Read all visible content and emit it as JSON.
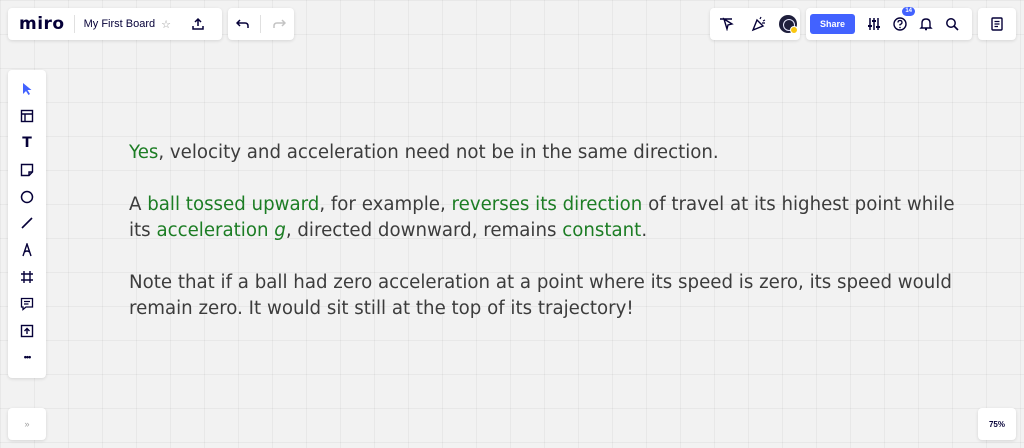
{
  "colors": {
    "accent": "#4262ff",
    "highlight_text": "#1c7d24",
    "body_text": "#3c3c3c",
    "canvas": "#f2f2f2"
  },
  "header": {
    "logo": "miro",
    "board_title": "My First Board",
    "star_icon": "☆",
    "export_icon": "upload-icon",
    "undo_icon": "undo-icon",
    "redo_icon": "redo-icon"
  },
  "collab": {
    "cursor_icon": "cursor-icon",
    "celebrate_icon": "confetti-icon",
    "avatar_icon": "user-avatar"
  },
  "topright": {
    "share_label": "Share",
    "settings_icon": "sliders-icon",
    "help_badge": "14",
    "help_icon": "help-icon",
    "bell_icon": "bell-icon",
    "search_icon": "search-icon",
    "menu_icon": "notes-icon"
  },
  "toolbar": {
    "items": [
      {
        "name": "select",
        "icon": "cursor-arrow-icon"
      },
      {
        "name": "templates",
        "icon": "template-icon"
      },
      {
        "name": "text",
        "icon": "text-icon",
        "glyph": "T"
      },
      {
        "name": "sticky-note",
        "icon": "sticky-note-icon"
      },
      {
        "name": "shape",
        "icon": "circle-icon"
      },
      {
        "name": "line",
        "icon": "line-icon"
      },
      {
        "name": "pen",
        "icon": "pen-icon"
      },
      {
        "name": "frame",
        "icon": "frame-icon"
      },
      {
        "name": "comment",
        "icon": "comment-icon"
      },
      {
        "name": "upload",
        "icon": "upload-icon"
      },
      {
        "name": "more",
        "icon": "more-icon",
        "glyph": "•••"
      }
    ]
  },
  "footer": {
    "expand_icon": "»",
    "zoom": "75%"
  },
  "board_text": {
    "p1": {
      "yes": "Yes",
      "rest": ", velocity and acceleration need not be in the same direction."
    },
    "p2": {
      "a": "A ",
      "ball": "ball tossed upward",
      "for_example": ", for example, ",
      "reverses": "reverses its direction",
      "of_travel": " of travel at its highest point while",
      "its": "its ",
      "acceleration": "acceleration ",
      "g": "g",
      "directed": ", directed downward, remains ",
      "constant": "constant",
      "period": "."
    },
    "p3": {
      "line1": "Note that if a ball had zero acceleration at a point where its speed is zero, its speed would",
      "line2": "remain zero. It would sit still at the top of its trajectory!"
    }
  }
}
